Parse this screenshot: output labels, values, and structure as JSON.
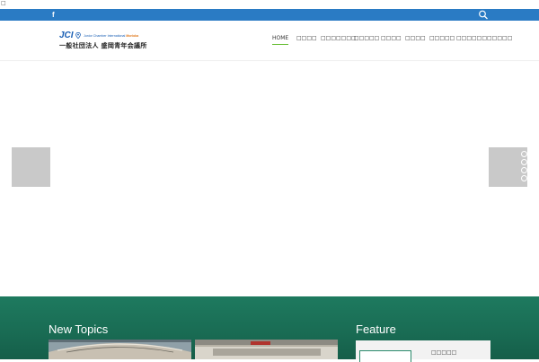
{
  "stray_glyph": "□",
  "topbar": {
    "facebook": "f"
  },
  "logo": {
    "mark": "JCI",
    "subtitle_prefix": "Junior Chamber International",
    "subtitle_city": "Morioka",
    "name_ja": "一般社団法人 盛岡青年会議所"
  },
  "nav": [
    {
      "label": "HOME",
      "active": true
    },
    {
      "label": "□□□□"
    },
    {
      "label": "□□□□□□□"
    },
    {
      "label": "□□□□□"
    },
    {
      "label": "□□□□"
    },
    {
      "label": "□□□□"
    },
    {
      "label": "□□□□□"
    },
    {
      "label": "□□□□□□□□□□□"
    }
  ],
  "sections": {
    "new_topics": "New Topics",
    "feature": "Feature",
    "feature_card_text": "□□□□□"
  },
  "colors": {
    "topbar": "#2a7bc4",
    "band": "#1e7a5f",
    "nav_active_underline": "#6bbf3a"
  }
}
